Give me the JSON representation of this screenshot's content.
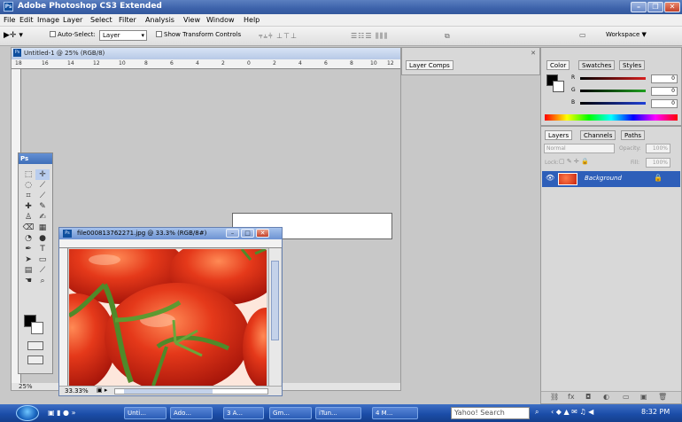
{
  "app": {
    "title": "Adobe Photoshop CS3 Extended"
  },
  "menu": [
    "File",
    "Edit",
    "Image",
    "Layer",
    "Select",
    "Filter",
    "Analysis",
    "View",
    "Window",
    "Help"
  ],
  "options": {
    "auto_select_label": "Auto-Select:",
    "auto_select_value": "Layer",
    "show_transform": "Show Transform Controls",
    "workspace": "Workspace ▼"
  },
  "document": {
    "tab_title": "Untitled-1 @ 25% (RGB/8)",
    "zoom": "25%"
  },
  "ruler_ticks": [
    "18",
    "16",
    "14",
    "12",
    "10",
    "8",
    "6",
    "4",
    "2",
    "0",
    "2",
    "4",
    "6",
    "8",
    "10",
    "12"
  ],
  "image_window": {
    "title": "file000813762271.jpg @ 33.3% (RGB/8#)",
    "zoom": "33.33%"
  },
  "panels": {
    "layer_comps": "Layer Comps",
    "color_tabs": [
      "Color",
      "Swatches",
      "Styles"
    ],
    "rgb": [
      {
        "ch": "R",
        "val": "0",
        "color": "#d82020"
      },
      {
        "ch": "G",
        "val": "0",
        "color": "#20a020"
      },
      {
        "ch": "B",
        "val": "0",
        "color": "#2040d8"
      }
    ],
    "layer_tabs": [
      "Layers",
      "Channels",
      "Paths"
    ],
    "blend_mode": "Normal",
    "opacity_label": "Opacity:",
    "opacity": "100%",
    "lock_label": "Lock:",
    "fill_label": "Fill:",
    "fill": "100%",
    "layer_name": "Background"
  },
  "taskbar": {
    "items": [
      "Unti...",
      "Ado...",
      "3 A...",
      "Gm...",
      "iTun...",
      "4 M..."
    ],
    "search": "Yahoo! Search",
    "time": "8:32 PM"
  },
  "colors": {
    "title_blue": "#3c62aa",
    "selected_layer": "#2e5fb9",
    "tomato": "#e0391a"
  }
}
